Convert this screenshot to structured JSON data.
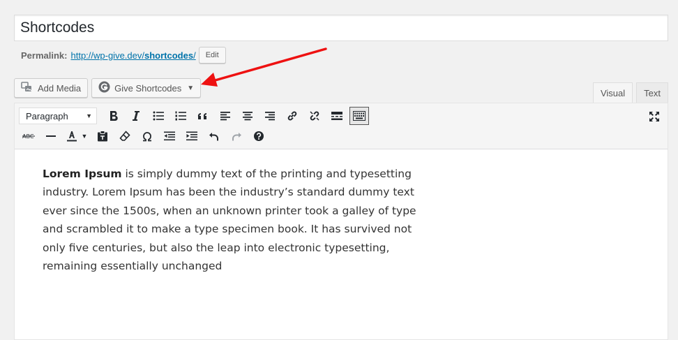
{
  "title": {
    "value": "Shortcodes"
  },
  "permalink": {
    "label": "Permalink:",
    "url_prefix": "http://wp-give.dev/",
    "slug": "shortcodes",
    "url_suffix": "/",
    "edit_label": "Edit"
  },
  "media_buttons": {
    "add_media": "Add Media",
    "give_shortcodes": "Give Shortcodes",
    "caret": "▼"
  },
  "editor_tabs": {
    "visual": "Visual",
    "text": "Text"
  },
  "toolbar": {
    "format_select": "Paragraph",
    "format_caret": "▼",
    "text_color_caret": "▼"
  },
  "content": {
    "bold_lead": "Lorem Ipsum",
    "body": " is simply dummy text of the printing and typesetting industry. Lorem Ipsum has been the industry’s standard dummy text ever since the 1500s, when an unknown printer took a galley of type and scrambled it to make a type specimen book. It has survived not only five centuries, but also the leap into electronic typesetting, remaining essentially unchanged"
  },
  "colors": {
    "annotation_arrow": "#ee1111",
    "link": "#0073aa"
  }
}
